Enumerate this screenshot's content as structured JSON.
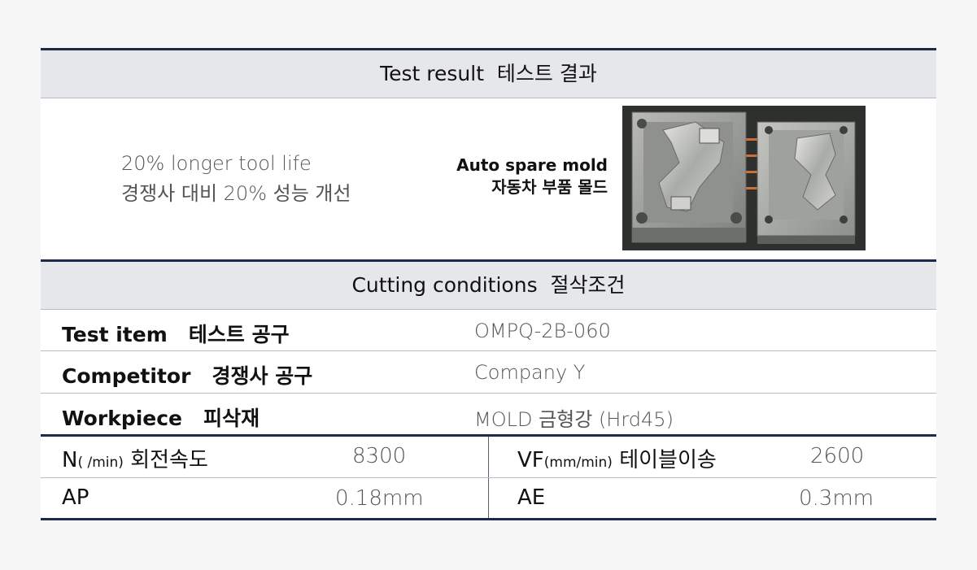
{
  "result_header": {
    "en": "Test result",
    "ko": "테스트 결과"
  },
  "result": {
    "line1": "20% longer tool life",
    "line2": "경쟁사 대비 20% 성능 개선",
    "part_en": "Auto spare mold",
    "part_ko": "자동차 부품 몰드"
  },
  "conditions_header": {
    "en": "Cutting conditions",
    "ko": "절삭조건"
  },
  "rows": [
    {
      "label_en": "Test item",
      "label_ko": "테스트 공구",
      "value": "OMPQ-2B-060"
    },
    {
      "label_en": "Competitor",
      "label_ko": "경쟁사 공구",
      "value": "Company Y"
    },
    {
      "label_en": "Workpiece",
      "label_ko": "피삭재",
      "value": "MOLD 금형강 (Hrd45)"
    }
  ],
  "params": {
    "n": {
      "symbol": "N",
      "unit": "( /min)",
      "ko": "회전속도",
      "value": "8300"
    },
    "vf": {
      "symbol": "VF",
      "unit": "(mm/min)",
      "ko": "테이블이송",
      "value": "2600"
    },
    "ap": {
      "symbol": "AP",
      "value": "0.18mm"
    },
    "ae": {
      "symbol": "AE",
      "value": "0.3mm"
    }
  },
  "colors": {
    "navy_rule": "#1f2a48",
    "header_band": "#e6e7eb",
    "page_bg": "#f6f6f6"
  }
}
